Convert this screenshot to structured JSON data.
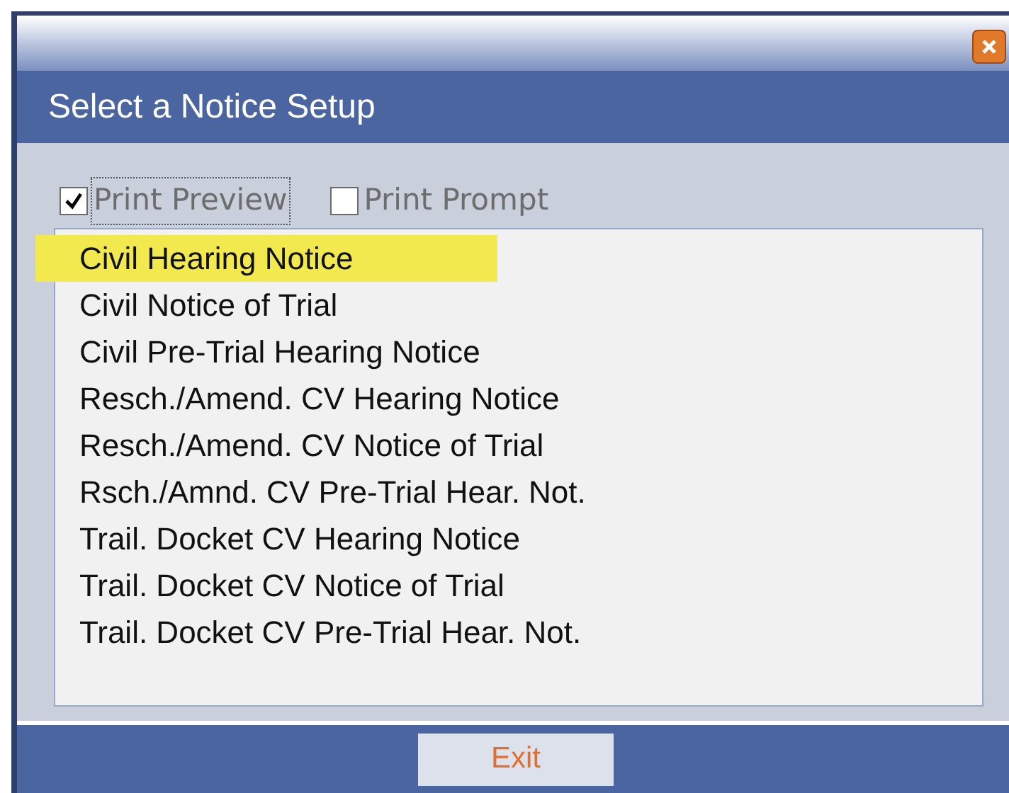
{
  "window": {
    "title": "Select a Notice Setup"
  },
  "options": [
    {
      "label": "Print Preview",
      "checked": true,
      "focused": true
    },
    {
      "label": "Print Prompt",
      "checked": false,
      "focused": false
    }
  ],
  "notices": [
    {
      "label": "Civil Hearing Notice",
      "selected": true
    },
    {
      "label": "Civil Notice of Trial",
      "selected": false
    },
    {
      "label": "Civil Pre-Trial Hearing Notice",
      "selected": false
    },
    {
      "label": "Resch./Amend. CV Hearing Notice",
      "selected": false
    },
    {
      "label": "Resch./Amend. CV Notice of Trial",
      "selected": false
    },
    {
      "label": "Rsch./Amnd. CV Pre-Trial Hear. Not.",
      "selected": false
    },
    {
      "label": "Trail. Docket CV Hearing Notice",
      "selected": false
    },
    {
      "label": "Trail. Docket CV Notice of Trial",
      "selected": false
    },
    {
      "label": "Trail. Docket CV Pre-Trial Hear. Not.",
      "selected": false
    }
  ],
  "buttons": [
    {
      "label": "Exit"
    }
  ]
}
